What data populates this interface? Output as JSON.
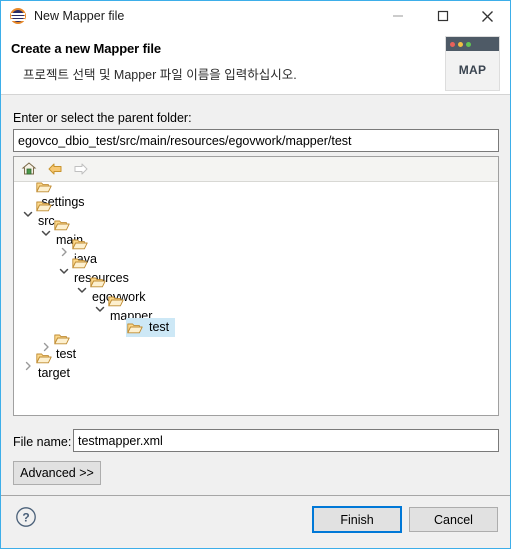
{
  "window": {
    "title": "New Mapper file",
    "icon": "eclipse-icon",
    "border_color": "#3daee9",
    "controls": [
      {
        "name": "minimize",
        "glyph": "minimize-icon"
      },
      {
        "name": "maximize",
        "glyph": "maximize-icon"
      },
      {
        "name": "close",
        "glyph": "close-icon"
      }
    ]
  },
  "header": {
    "title": "Create a new Mapper file",
    "subtitle": "프로젝트 선택 및 Mapper 파일 이름을 입력하십시오.",
    "banner_icon": {
      "name": "map-banner-icon",
      "label": "MAP",
      "dots": [
        "#e8615a",
        "#f1bf42",
        "#62c554"
      ],
      "bar_color": "#4e5a66"
    }
  },
  "form": {
    "parent_folder_label": "Enter or select the parent folder:",
    "parent_folder_value": "egovco_dbio_test/src/main/resources/egovwork/mapper/test",
    "parent_folder_placeholder": "",
    "file_name_label": "File name:",
    "file_name_value": "testmapper.xml",
    "file_name_placeholder": "",
    "advanced_label": "Advanced >>"
  },
  "tree": {
    "toolbar": [
      {
        "name": "home-icon",
        "enabled": true
      },
      {
        "name": "back-arrow-icon",
        "enabled": true
      },
      {
        "name": "forward-arrow-icon",
        "enabled": false
      }
    ],
    "selection_color": "#cde8f6",
    "rows": [
      {
        "label": ".settings",
        "depth": 1,
        "twisty": "none",
        "selected": false
      },
      {
        "label": "src",
        "depth": 1,
        "twisty": "expanded",
        "selected": false
      },
      {
        "label": "main",
        "depth": 2,
        "twisty": "expanded",
        "selected": false
      },
      {
        "label": "java",
        "depth": 3,
        "twisty": "collapsed",
        "selected": false
      },
      {
        "label": "resources",
        "depth": 3,
        "twisty": "expanded",
        "selected": false
      },
      {
        "label": "egovwork",
        "depth": 4,
        "twisty": "expanded",
        "selected": false
      },
      {
        "label": "mapper",
        "depth": 5,
        "twisty": "expanded",
        "selected": false
      },
      {
        "label": "test",
        "depth": 6,
        "twisty": "none",
        "selected": true
      },
      {
        "label": "test",
        "depth": 2,
        "twisty": "collapsed",
        "selected": false
      },
      {
        "label": "target",
        "depth": 1,
        "twisty": "collapsed",
        "selected": false
      }
    ]
  },
  "footer": {
    "help_icon": "help-icon",
    "finish_label": "Finish",
    "cancel_label": "Cancel",
    "focus_color": "#0078d7"
  }
}
